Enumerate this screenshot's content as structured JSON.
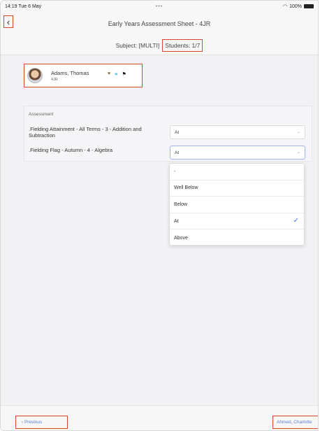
{
  "status_bar": {
    "time": "14:19",
    "date": "Tue 6 May",
    "dots": "•••",
    "battery": "100%"
  },
  "header": {
    "back_icon": "‹",
    "title": "Early Years Assessment Sheet - 4JR",
    "subject": "Subject: [MULTI]",
    "students": "Students: 1/7"
  },
  "student": {
    "name": "Adams, Thomas",
    "class": "4JR",
    "icons": [
      "heart-icon",
      "star-icon",
      "flag-icon"
    ]
  },
  "assessment": {
    "section_label": "Assessment",
    "rows": [
      {
        "label": ".Fielding Attainment - All Terms - 3 - Addition and Subtraction",
        "value": "At"
      },
      {
        "label": ".Fielding Flag - Autumn - 4 - Algebra",
        "value": "At"
      }
    ]
  },
  "dropdown": {
    "options": [
      "-",
      "Well Below",
      "Below",
      "At",
      "Above"
    ],
    "selected": "At"
  },
  "footer": {
    "previous": "‹  Previous",
    "next": "Ahmed, Charlotte"
  },
  "colors": {
    "highlight": "#d9472b",
    "link": "#5a7fd0",
    "check": "#3b6fd8"
  }
}
